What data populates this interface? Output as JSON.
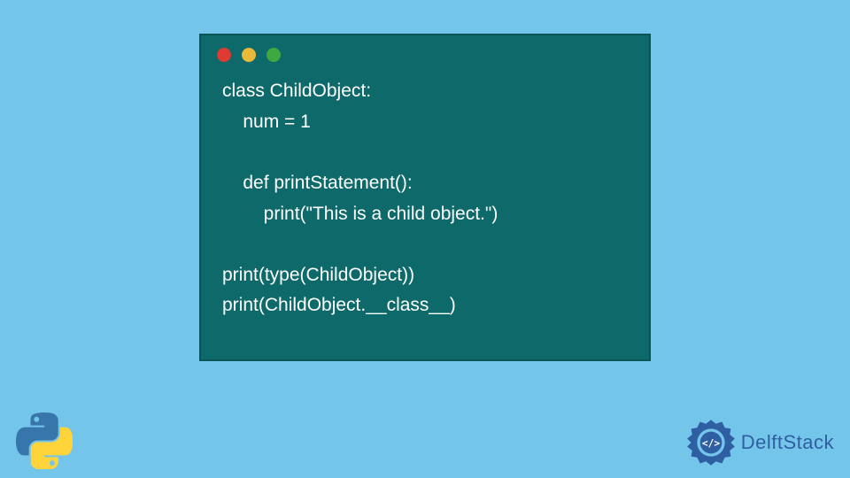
{
  "code": {
    "lines": [
      "class ChildObject:",
      "    num = 1",
      "",
      "    def printStatement():",
      "        print(\"This is a child object.\")",
      "",
      "print(type(ChildObject))",
      "print(ChildObject.__class__)"
    ]
  },
  "brand": {
    "name": "DelftStack"
  },
  "colors": {
    "bg": "#74c5ea",
    "windowBg": "#0e6a6a",
    "dotRed": "#dd3b33",
    "dotYellow": "#e9b93a",
    "dotGreen": "#3fa83f",
    "brandBlue": "#2f5fa3"
  }
}
